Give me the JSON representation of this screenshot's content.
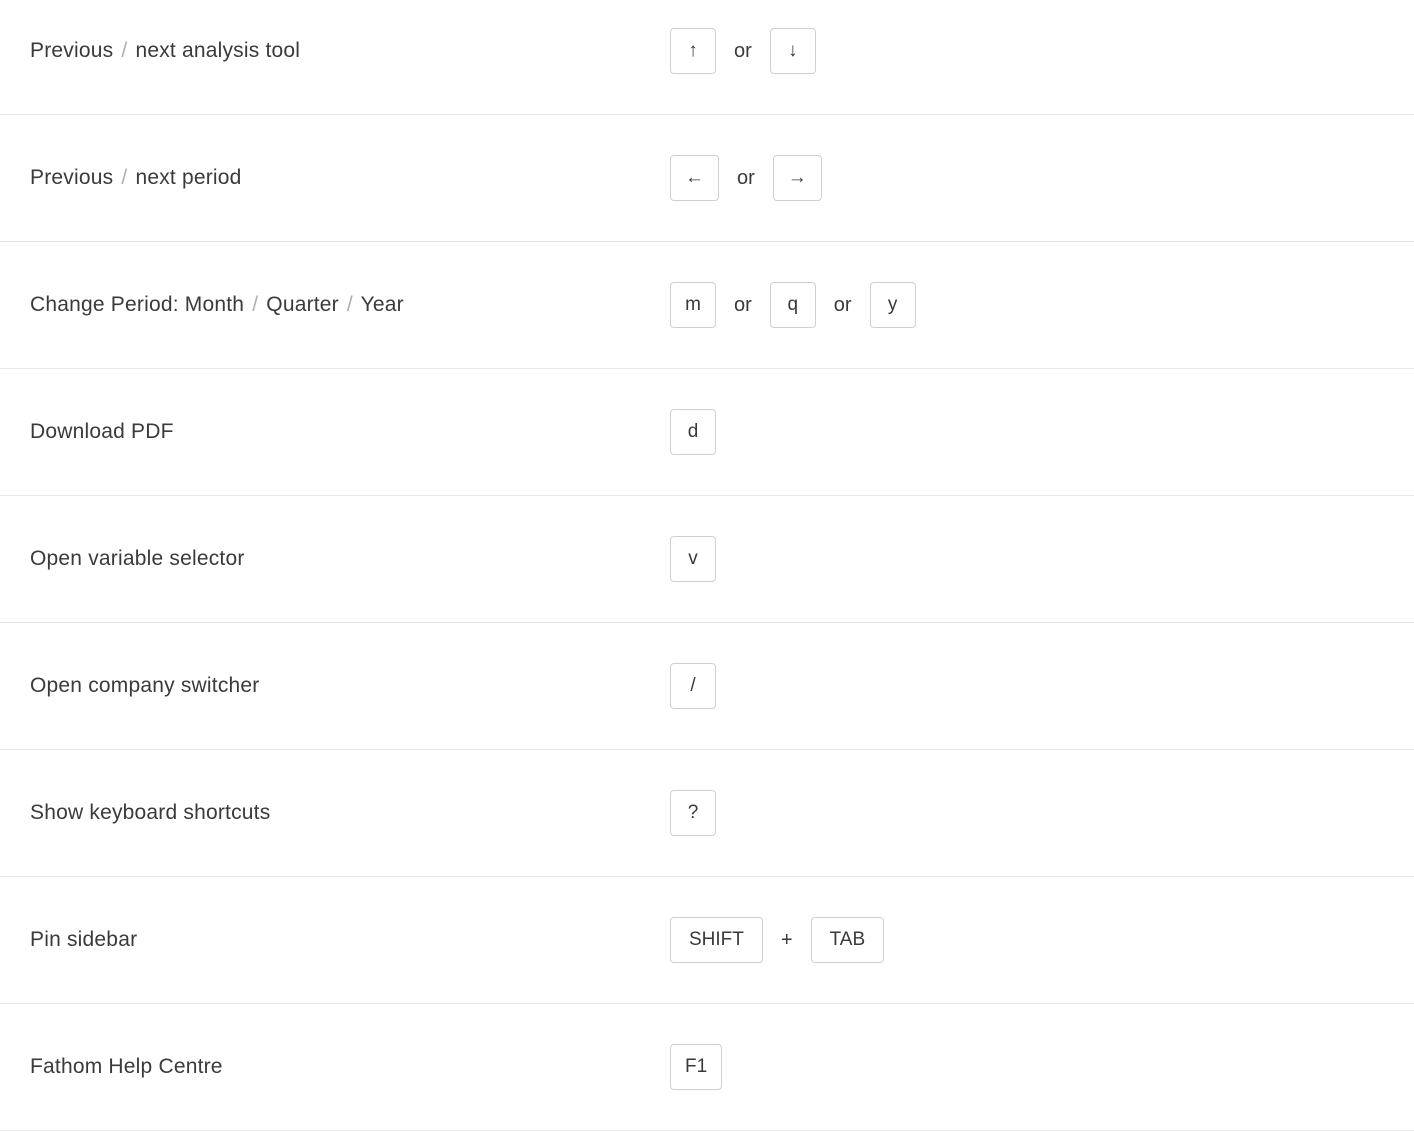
{
  "joiners": {
    "or": "or",
    "plus": "+"
  },
  "slash": "/",
  "rows": [
    {
      "label_parts": [
        "Previous",
        "next analysis tool"
      ],
      "keys": [
        {
          "type": "key",
          "value": "↑",
          "icon": "arrow-up-icon"
        },
        {
          "type": "joiner",
          "value": "or"
        },
        {
          "type": "key",
          "value": "↓",
          "icon": "arrow-down-icon"
        }
      ]
    },
    {
      "label_parts": [
        "Previous",
        "next period"
      ],
      "keys": [
        {
          "type": "key",
          "value": "←",
          "icon": "arrow-left-icon"
        },
        {
          "type": "joiner",
          "value": "or"
        },
        {
          "type": "key",
          "value": "→",
          "icon": "arrow-right-icon"
        }
      ]
    },
    {
      "label_parts": [
        "Change Period: Month",
        "Quarter",
        "Year"
      ],
      "keys": [
        {
          "type": "key",
          "value": "m"
        },
        {
          "type": "joiner",
          "value": "or"
        },
        {
          "type": "key",
          "value": "q"
        },
        {
          "type": "joiner",
          "value": "or"
        },
        {
          "type": "key",
          "value": "y"
        }
      ]
    },
    {
      "label_parts": [
        "Download PDF"
      ],
      "keys": [
        {
          "type": "key",
          "value": "d"
        }
      ]
    },
    {
      "label_parts": [
        "Open variable selector"
      ],
      "keys": [
        {
          "type": "key",
          "value": "v"
        }
      ]
    },
    {
      "label_parts": [
        "Open company switcher"
      ],
      "keys": [
        {
          "type": "key",
          "value": "/"
        }
      ]
    },
    {
      "label_parts": [
        "Show keyboard shortcuts"
      ],
      "keys": [
        {
          "type": "key",
          "value": "?"
        }
      ]
    },
    {
      "label_parts": [
        "Pin sidebar"
      ],
      "keys": [
        {
          "type": "key",
          "value": "SHIFT",
          "wide": true
        },
        {
          "type": "joiner",
          "value": "+"
        },
        {
          "type": "key",
          "value": "TAB",
          "wide": true
        }
      ]
    },
    {
      "label_parts": [
        "Fathom Help Centre"
      ],
      "keys": [
        {
          "type": "key",
          "value": "F1"
        }
      ]
    }
  ]
}
